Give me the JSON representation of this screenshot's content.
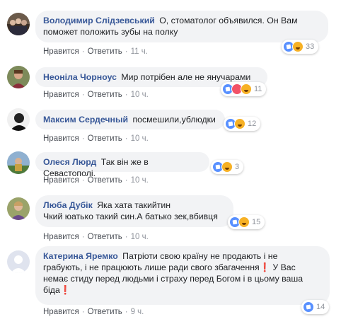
{
  "comments": [
    {
      "author": "Володимир Слідзевський",
      "text_lines": [
        "О, стоматолог объявился. Он Вам",
        "поможет положить зубы на полку"
      ],
      "like_label": "Нравится",
      "reply_label": "Ответить",
      "time": "11 ч.",
      "reactions": [
        "like",
        "haha"
      ],
      "reaction_count": "33"
    },
    {
      "author": "Неоніла Чорноус",
      "text_lines": [
        "Мир потрібен але не янучарами"
      ],
      "like_label": "Нравится",
      "reply_label": "Ответить",
      "time": "10 ч.",
      "reactions": [
        "like",
        "love",
        "haha"
      ],
      "reaction_count": "11"
    },
    {
      "author": "Максим Сердечный",
      "text_lines": [
        "посмешили,ублюдки"
      ],
      "like_label": "Нравится",
      "reply_label": "Ответить",
      "time": "10 ч.",
      "reactions": [
        "like",
        "haha"
      ],
      "reaction_count": "12"
    },
    {
      "author": "Олеся Люрд",
      "text_lines": [
        "Так він же в Севастополі."
      ],
      "like_label": "Нравится",
      "reply_label": "Ответить",
      "time": "10 ч.",
      "reactions": [
        "like",
        "haha"
      ],
      "reaction_count": "3"
    },
    {
      "author": "Люба Дубік",
      "text_lines": [
        "Яка хата такийтин",
        "Чкий юатько такий син.А батько зек,вбивця"
      ],
      "like_label": "Нравится",
      "reply_label": "Ответить",
      "time": "10 ч.",
      "reactions": [
        "like",
        "haha"
      ],
      "reaction_count": "15"
    },
    {
      "author": "Катерина Яремко",
      "text_lines": [
        "Патріоти свою країну не продають і не",
        "грабують, і не працюють лише ради свого збагачення❗ У Вас",
        "немає стиду перед людьми і страху перед Богом і в цьому ваша",
        "біда❗"
      ],
      "like_label": "Нравится",
      "reply_label": "Ответить",
      "time": "9 ч.",
      "reactions": [
        "like"
      ],
      "reaction_count": "14"
    }
  ],
  "colors": {
    "author": "#385898",
    "bubble": "#f2f3f5",
    "meta": "#90949c",
    "like": "#5890ff",
    "haha": "#f7b125",
    "love": "#f25268"
  }
}
